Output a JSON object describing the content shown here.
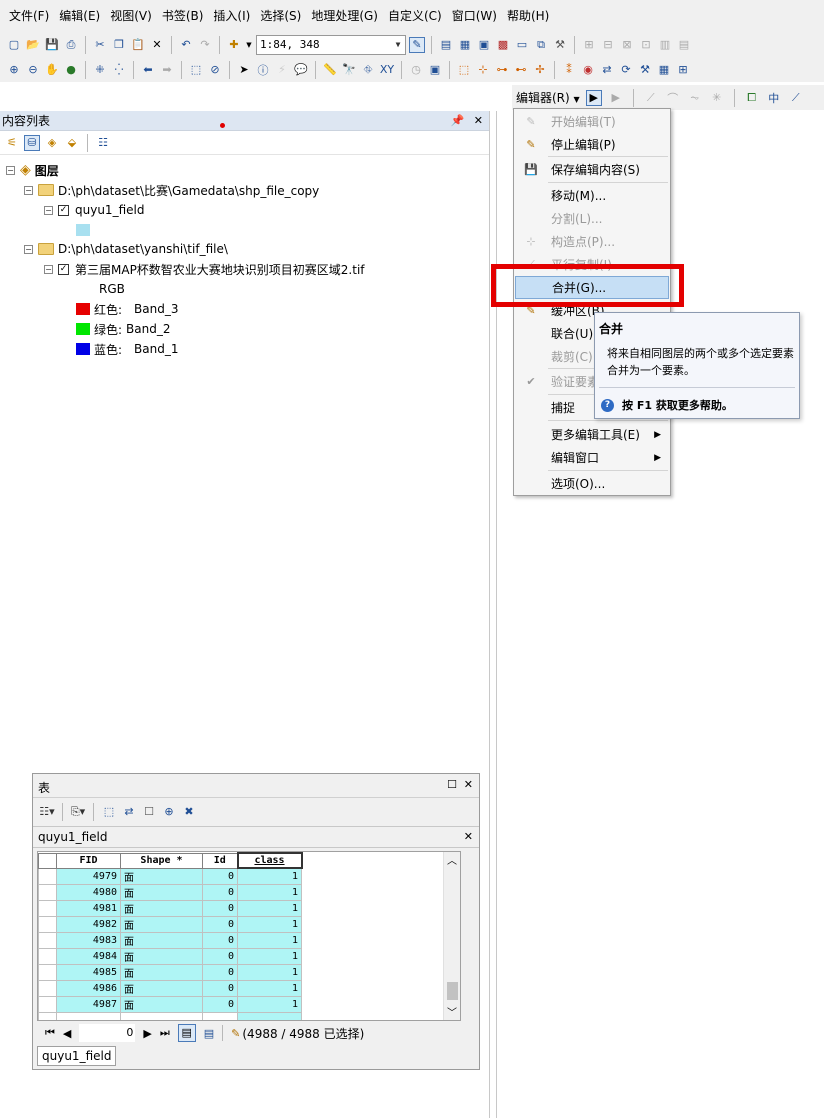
{
  "menubar": {
    "items": [
      "文件(F)",
      "编辑(E)",
      "视图(V)",
      "书签(B)",
      "插入(I)",
      "选择(S)",
      "地理处理(G)",
      "自定义(C)",
      "窗口(W)",
      "帮助(H)"
    ]
  },
  "toolbar": {
    "scale": "1:84, 348"
  },
  "editor_toolbar": {
    "label": "编辑器(R)"
  },
  "toc": {
    "title": "内容列表",
    "root": "图层",
    "group1_path": "D:\\ph\\dataset\\比赛\\Gamedata\\shp_file_copy",
    "layer1": "quyu1_field",
    "group2_path": "D:\\ph\\dataset\\yanshi\\tif_file\\",
    "layer2": "第三届MAP杯数智农业大赛地块识别项目初赛区域2.tif",
    "rgb_label": "RGB",
    "bands": [
      {
        "label": "红色:",
        "band": "Band_3",
        "color": "#e60000"
      },
      {
        "label": "绿色:",
        "band": "Band_2",
        "color": "#00e600"
      },
      {
        "label": "蓝色:",
        "band": "Band_1",
        "color": "#0000e6"
      }
    ],
    "layer1_color": "#a8e0f0"
  },
  "editor_menu": {
    "items": [
      {
        "label": "开始编辑(T)",
        "disabled": true,
        "icon": "pencil-icon"
      },
      {
        "label": "停止编辑(P)",
        "disabled": false,
        "icon": "stop-edit-icon"
      },
      {
        "label": "保存编辑内容(S)",
        "disabled": false,
        "icon": "save-icon"
      },
      {
        "label": "移动(M)...",
        "disabled": false,
        "icon": ""
      },
      {
        "label": "分割(L)...",
        "disabled": true,
        "icon": ""
      },
      {
        "label": "构造点(P)...",
        "disabled": true,
        "icon": "construct-points-icon"
      },
      {
        "label": "平行复制(I)...",
        "disabled": true,
        "icon": "copy-parallel-icon"
      },
      {
        "label": "合并(G)...",
        "disabled": false,
        "icon": ""
      },
      {
        "label": "缓冲区(B)...",
        "disabled": false,
        "icon": "buffer-icon"
      },
      {
        "label": "联合(U)...",
        "disabled": false,
        "icon": ""
      },
      {
        "label": "裁剪(C)...",
        "disabled": true,
        "icon": ""
      },
      {
        "label": "验证要素",
        "disabled": true,
        "icon": "validate-icon"
      },
      {
        "label": "捕捉",
        "disabled": false,
        "icon": ""
      },
      {
        "label": "更多编辑工具(E)",
        "disabled": false,
        "icon": ""
      },
      {
        "label": "编辑窗口",
        "disabled": false,
        "icon": ""
      },
      {
        "label": "选项(O)...",
        "disabled": false,
        "icon": ""
      }
    ]
  },
  "tooltip": {
    "title": "合并",
    "body": "将来自相同图层的两个或多个选定要素合并为一个要素。",
    "help": "按 F1 获取更多帮助。"
  },
  "table_window": {
    "title": "表",
    "layer_tab": "quyu1_field",
    "columns": [
      "FID",
      "Shape *",
      "Id",
      "class"
    ],
    "rows": [
      [
        "4979",
        "面",
        "0",
        "1"
      ],
      [
        "4980",
        "面",
        "0",
        "1"
      ],
      [
        "4981",
        "面",
        "0",
        "1"
      ],
      [
        "4982",
        "面",
        "0",
        "1"
      ],
      [
        "4983",
        "面",
        "0",
        "1"
      ],
      [
        "4984",
        "面",
        "0",
        "1"
      ],
      [
        "4985",
        "面",
        "0",
        "1"
      ],
      [
        "4986",
        "面",
        "0",
        "1"
      ],
      [
        "4987",
        "面",
        "0",
        "1"
      ]
    ],
    "record_index": "0",
    "selection_status": "(4988 / 4988 已选择)",
    "bottom_tab": "quyu1_field"
  }
}
